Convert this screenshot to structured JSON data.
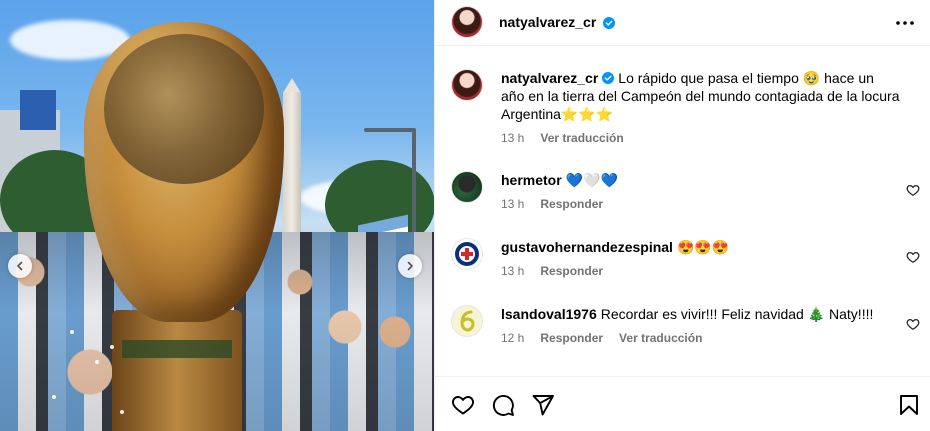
{
  "post": {
    "media": {
      "alt": "",
      "prev_icon": "chevron-left-icon",
      "next_icon": "chevron-right-icon"
    },
    "header": {
      "username": "natyalvarez_cr",
      "verified_icon": "verified-badge-icon",
      "more_icon": "more-horizontal-icon"
    },
    "caption": {
      "username": "natyalvarez_cr",
      "text": "Lo rápido que pasa el tiempo 🥹 hace un año en la tierra del Campeón del mundo contagiada de la locura Argentina⭐⭐⭐",
      "time": "13 h",
      "translate_label": "Ver traducción"
    },
    "comments": [
      {
        "username": "hermetor",
        "text": "💙🤍💙",
        "time": "13 h",
        "reply_label": "Responder"
      },
      {
        "username": "gustavohernandezespinal",
        "text": "😍😍😍",
        "time": "13 h",
        "reply_label": "Responder"
      },
      {
        "username": "lsandoval1976",
        "text": "Recordar es vivir!!! Feliz navidad 🎄 Naty!!!!",
        "time": "12 h",
        "reply_label": "Responder",
        "translate_label": "Ver traducción"
      }
    ],
    "actions": {
      "like_icon": "heart-icon",
      "comment_icon": "comment-icon",
      "share_icon": "send-icon",
      "save_icon": "bookmark-icon"
    },
    "colors": {
      "verified": "#0095f6",
      "meta_text": "#737373",
      "divider": "#efefef"
    }
  }
}
